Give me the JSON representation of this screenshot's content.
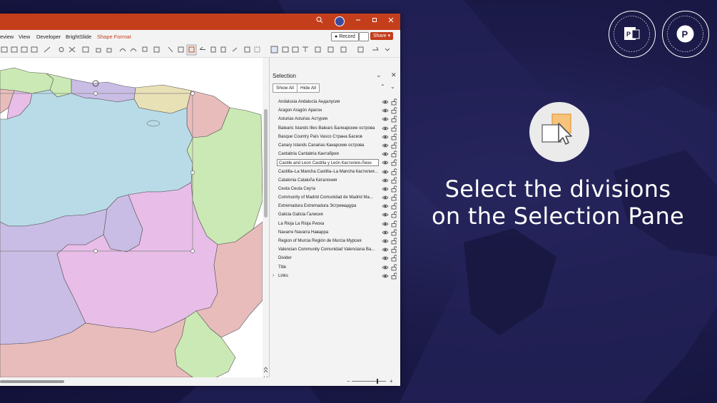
{
  "window": {
    "menu": [
      "eview",
      "View",
      "Developer",
      "BrightSlide",
      "Shape Format"
    ],
    "record_label": "Record",
    "share_label": "Share"
  },
  "selection_pane": {
    "title": "Selection",
    "show_all": "Show All",
    "hide_all": "Hide All",
    "items": [
      "Andalusia Andalucía Андалусия",
      "Aragon Aragón Арагон",
      "Asturias Asturias Астурия",
      "Balearic Islands Illes Balears Балеарские острова",
      "Basque Country País Vasco Страна Басков",
      "Canary Islands Canarias Канарские острова",
      "Cantabria Cantabria Кантабрия",
      "Castile and Leon Castilla y León Кастилия-Леон",
      "Castilla–La Mancha Castilla–La Mancha Кастилия–...",
      "Catalonia Cataluña Каталония",
      "Ceuta Ceuta Сеута",
      "Community of Madrid Comunidad de Madrid Ма...",
      "Extremadura Extremadura Эстремадура",
      "Galicia Galicia Галисия",
      "La Rioja La Rioja Риоха",
      "Navarre Navarra Наварра",
      "Region of Murcia Región de Murcia Мурсия",
      "Valencian Community Comunidad Valenciana Ва...",
      "Divider",
      "Title",
      "Links"
    ],
    "selected_index": 7
  },
  "headline": {
    "line1": "Select the divisions",
    "line2": "on the Selection Pane"
  },
  "colors": {
    "titlebar": "#c43e1c",
    "background": "#1c1b4a",
    "castile_leon": "#b9dbe8",
    "aragon_like": "#cbe9b4",
    "madrid_like": "#c9bde6",
    "mancha": "#e8bde8",
    "valencia": "#e9bcbc",
    "rioja": "#e8e1b6",
    "orange_accent": "#f7c27a"
  }
}
